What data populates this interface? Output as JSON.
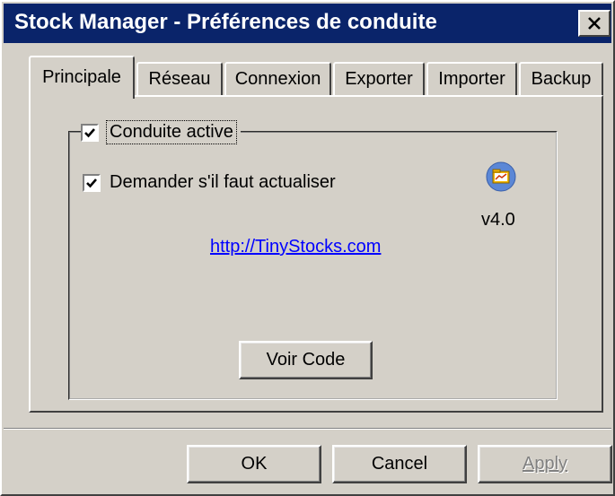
{
  "window": {
    "title": "Stock Manager - Préférences de conduite"
  },
  "tabs": [
    {
      "label": "Principale",
      "active": true
    },
    {
      "label": "Réseau"
    },
    {
      "label": "Connexion"
    },
    {
      "label": "Exporter"
    },
    {
      "label": "Importer"
    },
    {
      "label": "Backup"
    }
  ],
  "main": {
    "conduite_active": {
      "label": "Conduite active",
      "checked": true
    },
    "demander": {
      "label": "Demander s'il faut actualiser",
      "checked": true
    },
    "version": "v4.0",
    "link": "http://TinyStocks.com",
    "voir_code_label": "Voir Code",
    "app_icon": "folder-chart-icon"
  },
  "footer": {
    "ok_label": "OK",
    "cancel_label": "Cancel",
    "apply_label": "Apply"
  },
  "colors": {
    "titlebar": "#0a246a",
    "face": "#d4d0c8",
    "link": "#0000ff",
    "icon_bg": "#5b87d6",
    "icon_folder": "#f5b800"
  }
}
